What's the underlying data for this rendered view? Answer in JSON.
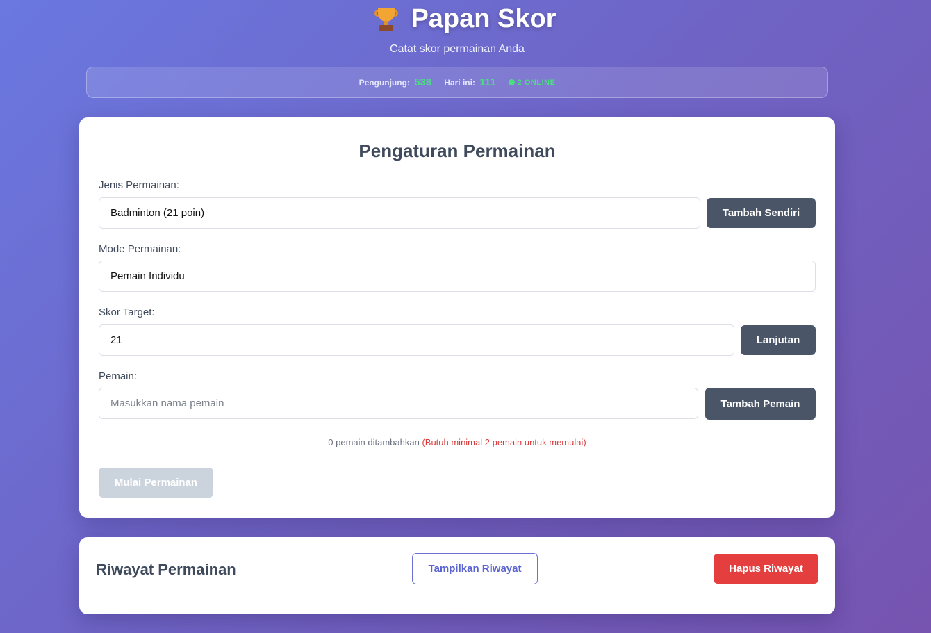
{
  "header": {
    "title": "Papan Skor",
    "icon": "trophy-icon",
    "subtitle": "Catat skor permainan Anda"
  },
  "stats": {
    "visitors_label": "Pengunjung:",
    "visitors_value": "538",
    "today_label": "Hari ini:",
    "today_value": "111",
    "online_text": "2 ONLINE"
  },
  "setup": {
    "title": "Pengaturan Permainan",
    "game_type_label": "Jenis Permainan:",
    "game_type_value": "Badminton (21 poin)",
    "add_custom_button": "Tambah Sendiri",
    "mode_label": "Mode Permainan:",
    "mode_value": "Pemain Individu",
    "target_label": "Skor Target:",
    "target_value": "21",
    "advanced_button": "Lanjutan",
    "players_label": "Pemain:",
    "player_placeholder": "Masukkan nama pemain",
    "add_player_button": "Tambah Pemain",
    "player_count_text": "0 pemain ditambahkan",
    "player_warning": "(Butuh minimal 2 pemain untuk memulai)",
    "start_button": "Mulai Permainan"
  },
  "history": {
    "title": "Riwayat Permainan",
    "show_button": "Tampilkan Riwayat",
    "clear_button": "Hapus Riwayat"
  },
  "colors": {
    "accent_green": "#4ade80",
    "danger": "#e53e3e",
    "dark_button": "#4a5568"
  }
}
